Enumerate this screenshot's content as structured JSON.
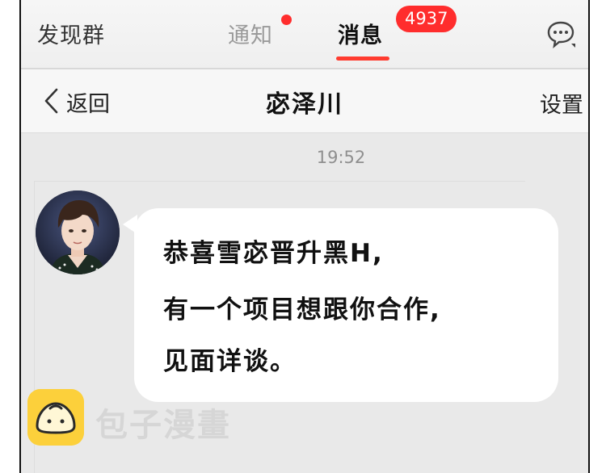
{
  "tabs": {
    "discover": "发现群",
    "notify": "通知",
    "messages": "消息",
    "messages_badge": "4937"
  },
  "nav": {
    "back_label": "返回",
    "title": "宓泽川",
    "settings": "设置"
  },
  "chat": {
    "timestamp": "19:52",
    "message_lines": [
      "恭喜雪宓晋升黑H,",
      "有一个项目想跟你合作,",
      "见面详谈。"
    ]
  },
  "watermark": {
    "text": "包子漫畫",
    "icon": "bun-icon"
  },
  "colors": {
    "accent_red": "#ff2d2d",
    "underline_red": "#ff3b2f",
    "chat_background": "#e9e9e9",
    "bubble": "#ffffff",
    "watermark_yellow": "#fcd03b"
  }
}
